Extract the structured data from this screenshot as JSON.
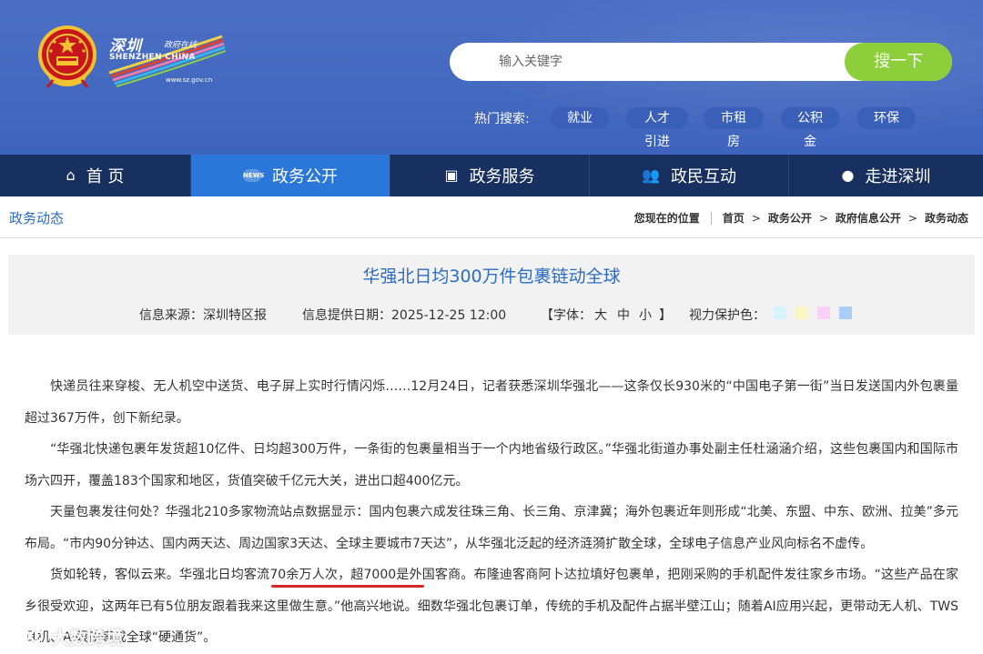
{
  "header": {
    "logo": {
      "cn": "深圳",
      "cn_small": "政府在线",
      "en": "SHENZHEN CHINA",
      "url": "www.sz.gov.cn"
    },
    "search": {
      "placeholder": "输入关键字",
      "button_label": "搜一下"
    },
    "hot_search": {
      "label": "热门搜索:",
      "items": [
        "就业",
        "人才引进",
        "市租房",
        "公积金",
        "环保"
      ]
    }
  },
  "nav": {
    "items": [
      {
        "label": "首 页",
        "icon": "home-icon"
      },
      {
        "label": "政务公开",
        "icon": "news-icon"
      },
      {
        "label": "政务服务",
        "icon": "monitor-icon"
      },
      {
        "label": "政民互动",
        "icon": "people-icon"
      },
      {
        "label": "走进深圳",
        "icon": "chat-icon"
      }
    ],
    "active_index": 1
  },
  "breadcrumb": {
    "section": "政务动态",
    "location_label": "您现在的位置",
    "items": [
      "首页",
      "政务公开",
      "政府信息公开",
      "政务动态"
    ]
  },
  "article": {
    "title": "华强北日均300万件包裹链动全球",
    "source": "信息来源：深圳特区报",
    "date": "信息提供日期：2025-12-25 12:00",
    "font_label": "【字体：",
    "font_large": "大",
    "font_medium": "中",
    "font_small": "小",
    "font_end": "】",
    "eye_label": "视力保护色：",
    "eye_colors": [
      "#d6f2fb",
      "#faf6c4",
      "#fbd1f7",
      "#a9cdf7"
    ],
    "paragraphs": [
      "快递员往来穿梭、无人机空中送货、电子屏上实时行情闪烁……12月24日，记者获悉深圳华强北——这条仅长930米的“中国电子第一街”当日发送国内外包裹量超过367万件，创下新纪录。",
      "“华强北快递包裹年发货超10亿件、日均超300万件，一条街的包裹量相当于一个内地省级行政区。”华强北街道办事处副主任杜涵涵介绍，这些包裹国内和国际市场六四开，覆盖183个国家和地区，货值突破千亿元大关，进出口超400亿元。",
      "天量包裹发往何处？华强北210多家物流站点数据显示：国内包裹六成发往珠三角、长三角、京津冀；海外包裹近年则形成“北美、东盟、中东、欧洲、拉美”多元布局。“市内90分钟达、国内两天达、周边国家3天达、全球主要城市7天达”，从华强北泛起的经济涟漪扩散全球，全球电子信息产业风向标名不虚传。",
      "货如轮转，客似云来。华强北日均客流70余万人次，超7000是外国客商。布隆迪客商阿卜达拉填好包裹单，把刚采购的手机配件发往家乡市场。“这些产品在家乡很受欢迎，这两年已有5位朋友跟着我来这里做生意。”他高兴地说。细数华强北包裹订单，传统的手机及配件占据半壁江山；随着AI应用兴起，更带动无人机、TWS耳机、AI眼镜等成全球“硬通货”。"
    ]
  },
  "watermark": {
    "text": "大数跨境"
  },
  "colors": {
    "header_bg": "#4a6fc4",
    "nav_bg": "#17305f",
    "nav_active": "#2b76d9",
    "search_button": "#8ccf3a",
    "title_blue": "#2b6cc4",
    "highlight_underline": "#d9262a"
  }
}
